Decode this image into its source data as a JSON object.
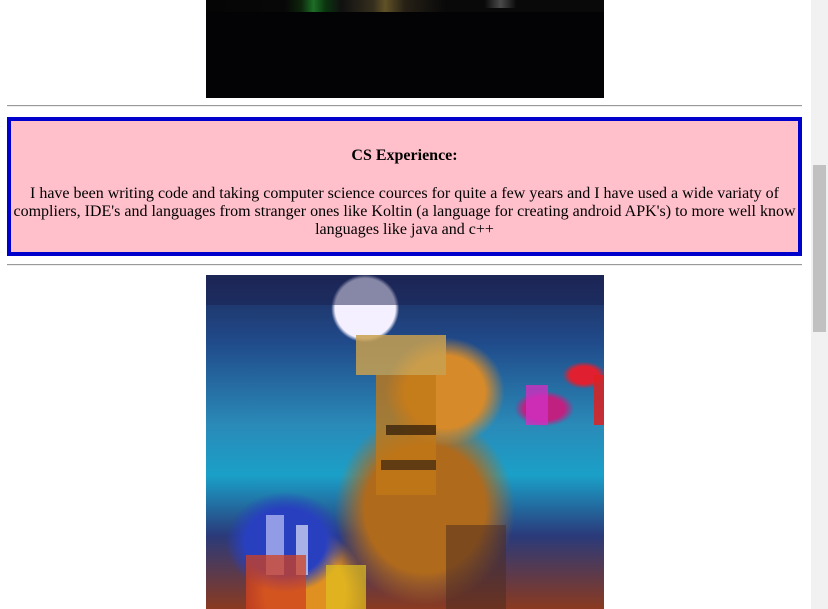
{
  "cs_section": {
    "title": "CS Experience:",
    "text": "I have been writing code and taking computer science cources for quite a few years and I have used a wide variaty of compliers, IDE's and languages from stranger ones like Koltin (a language for creating android APK's) to more well know languages like java and c++"
  },
  "colors": {
    "box_background": "#ffc0cb",
    "box_border": "#0000cc"
  },
  "icons": {
    "top_image": "pixel-art-image",
    "bottom_image": "pixel-art-image"
  }
}
